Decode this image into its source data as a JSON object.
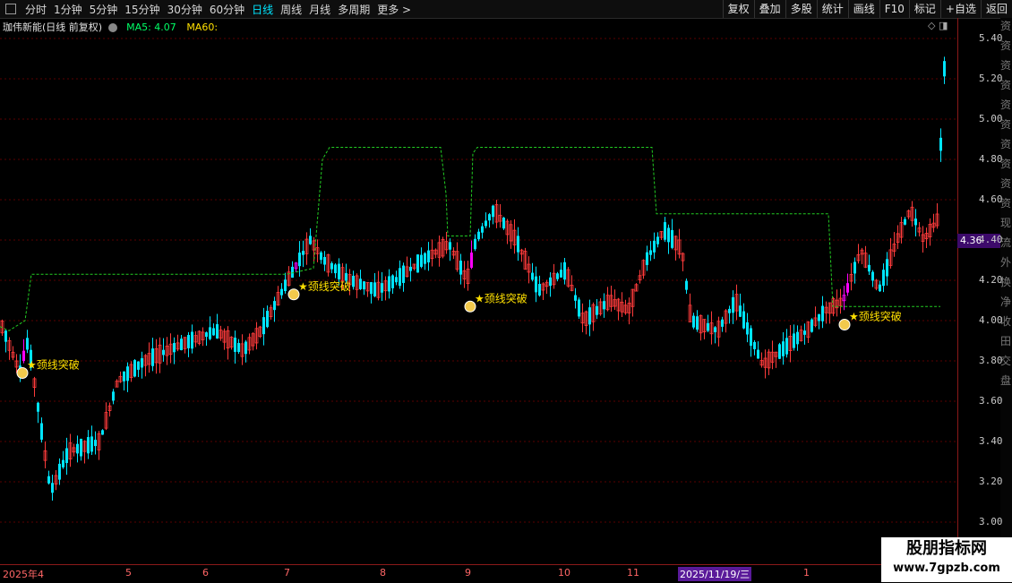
{
  "toolbar": {
    "periods": [
      "分时",
      "1分钟",
      "5分钟",
      "15分钟",
      "30分钟",
      "60分钟",
      "日线",
      "周线",
      "月线",
      "多周期",
      "更多 >"
    ],
    "active_index": 6,
    "right_buttons": [
      "复权",
      "叠加",
      "多股",
      "统计",
      "画线",
      "F10",
      "标记",
      "+自选",
      "返回"
    ]
  },
  "info": {
    "title": "珈伟新能(日线 前复权)",
    "ma5": "MA5: 4.07",
    "ma60": "MA60:"
  },
  "corner_icons": "◇ ◨",
  "price_axis": {
    "ticks": [
      "5.40",
      "5.20",
      "5.00",
      "4.80",
      "4.60",
      "4.40",
      "4.20",
      "4.00",
      "3.80",
      "3.60",
      "3.40",
      "3.20",
      "3.00"
    ],
    "current": "4.36"
  },
  "dates": [
    {
      "label": "2025年4",
      "hl": false
    },
    {
      "label": "5",
      "hl": false
    },
    {
      "label": "6",
      "hl": false
    },
    {
      "label": "7",
      "hl": false
    },
    {
      "label": "8",
      "hl": false
    },
    {
      "label": "9",
      "hl": false
    },
    {
      "label": "10",
      "hl": false
    },
    {
      "label": "11",
      "hl": false
    },
    {
      "label": "2025/11/19/三",
      "hl": true
    },
    {
      "label": "1",
      "hl": false
    }
  ],
  "signals": [
    {
      "label": "★颈线突破"
    },
    {
      "label": "★颈线突破"
    },
    {
      "label": "★颈线突破"
    },
    {
      "label": "★颈线突破"
    }
  ],
  "side_chars": [
    "资",
    "资",
    "资",
    "资",
    "资",
    "资",
    "资",
    "资",
    "资",
    "资",
    "现",
    "流",
    "外",
    "换",
    "净",
    "收",
    "田",
    "交",
    "盘"
  ],
  "colors": {
    "up": "#ff3b3b",
    "down": "#00e5ff",
    "signal": "#ff00ff",
    "neckline": "#22cc22",
    "grid": "#5a0000"
  },
  "watermark": {
    "line1": "股朋指标网",
    "line2": "www.7gpzb.com"
  }
}
